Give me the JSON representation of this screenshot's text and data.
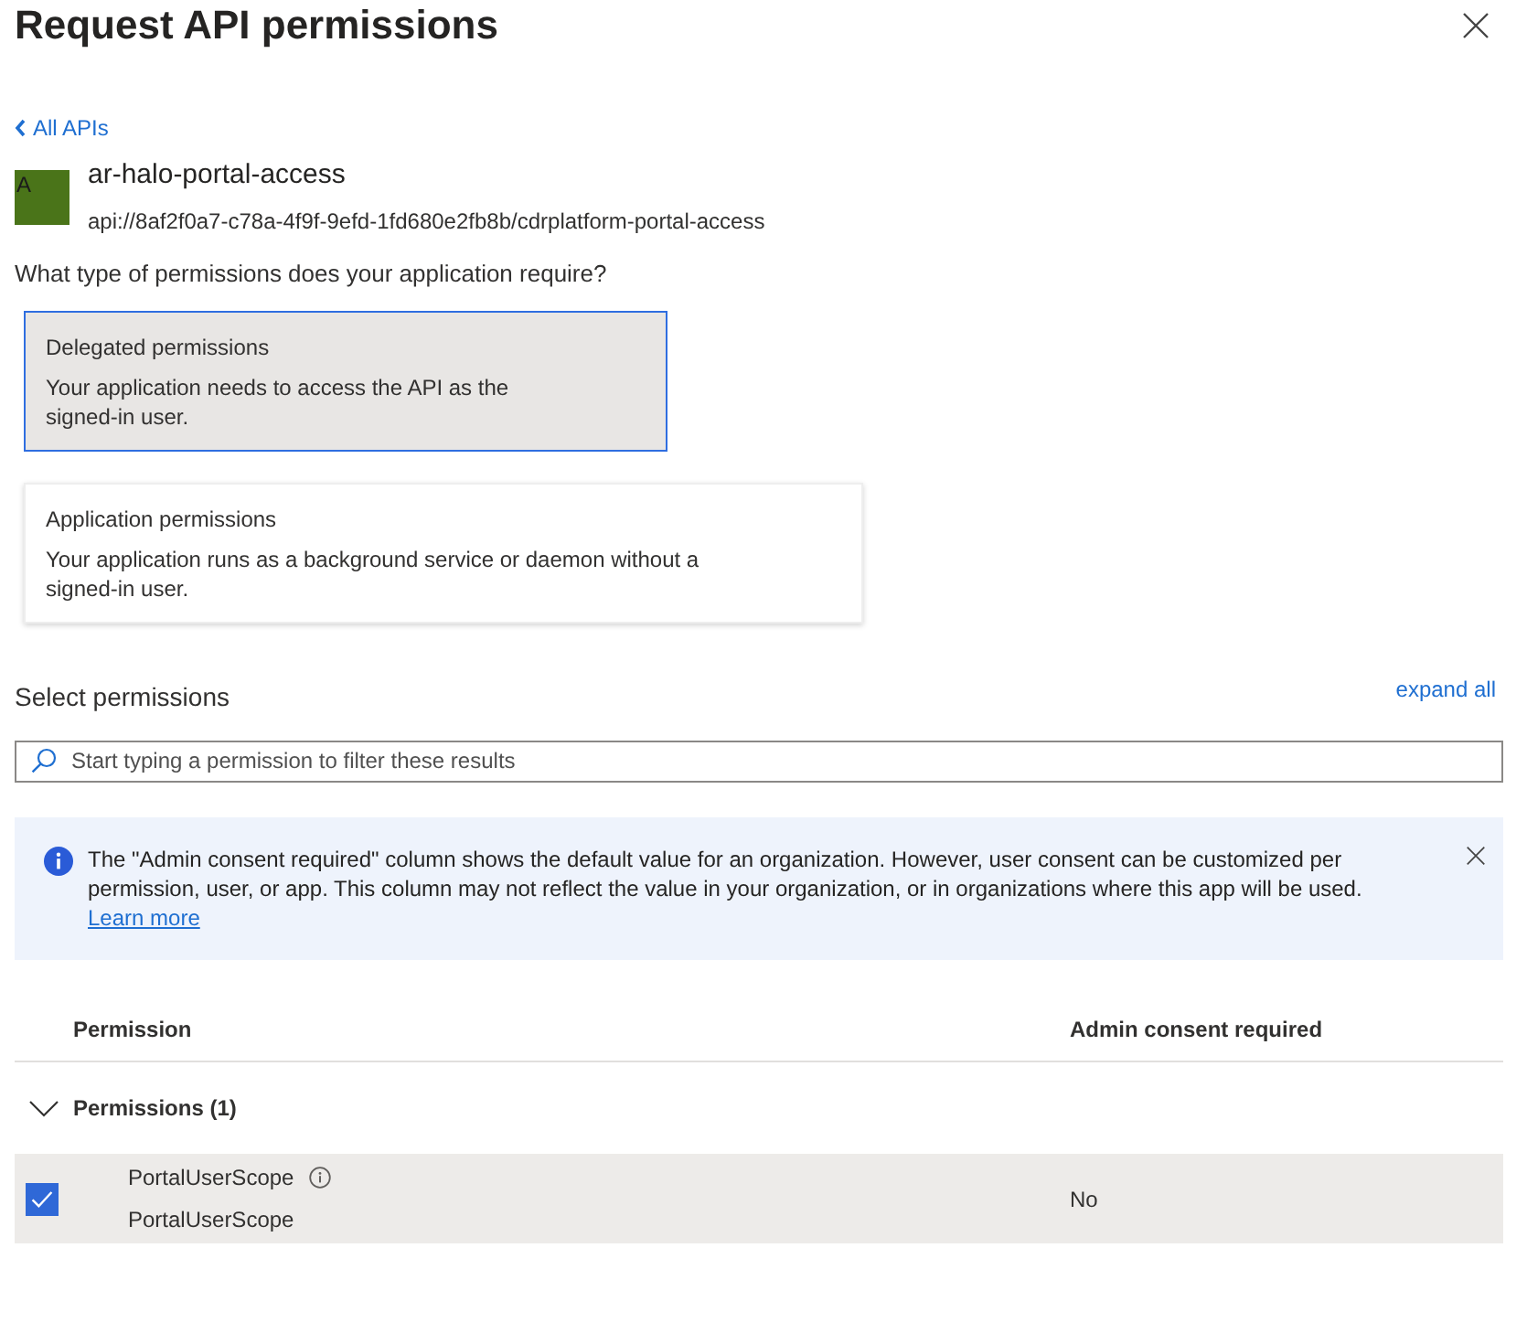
{
  "dialog": {
    "title": "Request API permissions"
  },
  "back_link": {
    "label": "All APIs"
  },
  "api": {
    "avatar_letter": "A",
    "name": "ar-halo-portal-access",
    "uri": "api://8af2f0a7-c78a-4f9f-9efd-1fd680e2fb8b/cdrplatform-portal-access"
  },
  "permission_type": {
    "question": "What type of permissions does your application require?",
    "options": [
      {
        "title": "Delegated permissions",
        "description": "Your application needs to access the API as the signed-in user.",
        "selected": true
      },
      {
        "title": "Application permissions",
        "description": "Your application runs as a background service or daemon without a signed-in user.",
        "selected": false
      }
    ]
  },
  "select_permissions": {
    "heading": "Select permissions",
    "expand_all": "expand all",
    "search": {
      "placeholder": "Start typing a permission to filter these results"
    }
  },
  "info_banner": {
    "text": "The \"Admin consent required\" column shows the default value for an organization. However, user consent can be customized per permission, user, or app. This column may not reflect the value in your organization, or in organizations where this app will be used.",
    "link": "Learn more"
  },
  "table": {
    "columns": [
      "Permission",
      "Admin consent required"
    ],
    "groups": [
      {
        "label": "Permissions (1)",
        "expanded": true,
        "rows": [
          {
            "name": "PortalUserScope",
            "description": "PortalUserScope",
            "admin_consent": "No",
            "checked": true
          }
        ]
      }
    ]
  }
}
